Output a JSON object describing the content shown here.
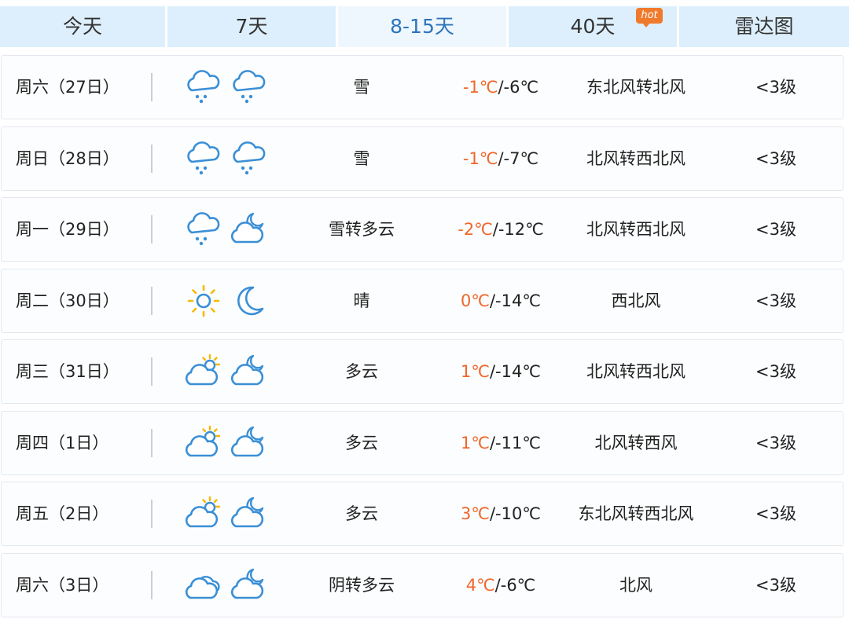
{
  "tabs": [
    {
      "label": "今天",
      "active": false
    },
    {
      "label": "7天",
      "active": false
    },
    {
      "label": "8-15天",
      "active": true
    },
    {
      "label": "40天",
      "active": false,
      "badge": "hot"
    },
    {
      "label": "雷达图",
      "active": false
    }
  ],
  "colors": {
    "accent": "#2e74b8",
    "tab_bg": "#ddeffc",
    "high_temp": "#f0662a",
    "badge": "#f07a2c",
    "icon_blue": "#3a8fd6",
    "sun_yellow": "#f5b800"
  },
  "days": [
    {
      "date": "周六（27日）",
      "day_icon": "snow-icon",
      "night_icon": "snow-icon",
      "condition": "雪",
      "high": "-1℃",
      "low": "/-6℃",
      "wind": "东北风转北风",
      "level": "<3级"
    },
    {
      "date": "周日（28日）",
      "day_icon": "snow-icon",
      "night_icon": "snow-icon",
      "condition": "雪",
      "high": "-1℃",
      "low": "/-7℃",
      "wind": "北风转西北风",
      "level": "<3级"
    },
    {
      "date": "周一（29日）",
      "day_icon": "snow-icon",
      "night_icon": "cloudy-night-icon",
      "condition": "雪转多云",
      "high": "-2℃",
      "low": "/-12℃",
      "wind": "北风转西北风",
      "level": "<3级"
    },
    {
      "date": "周二（30日）",
      "day_icon": "sun-icon",
      "night_icon": "moon-icon",
      "condition": "晴",
      "high": "0℃",
      "low": "/-14℃",
      "wind": "西北风",
      "level": "<3级"
    },
    {
      "date": "周三（31日）",
      "day_icon": "partly-cloudy-day-icon",
      "night_icon": "cloudy-night-icon",
      "condition": "多云",
      "high": "1℃",
      "low": "/-14℃",
      "wind": "北风转西北风",
      "level": "<3级"
    },
    {
      "date": "周四（1日）",
      "day_icon": "partly-cloudy-day-icon",
      "night_icon": "cloudy-night-icon",
      "condition": "多云",
      "high": "1℃",
      "low": "/-11℃",
      "wind": "北风转西风",
      "level": "<3级"
    },
    {
      "date": "周五（2日）",
      "day_icon": "partly-cloudy-day-icon",
      "night_icon": "cloudy-night-icon",
      "condition": "多云",
      "high": "3℃",
      "low": "/-10℃",
      "wind": "东北风转西北风",
      "level": "<3级"
    },
    {
      "date": "周六（3日）",
      "day_icon": "overcast-icon",
      "night_icon": "cloudy-night-icon",
      "condition": "阴转多云",
      "high": "4℃",
      "low": "/-6℃",
      "wind": "北风",
      "level": "<3级"
    }
  ]
}
